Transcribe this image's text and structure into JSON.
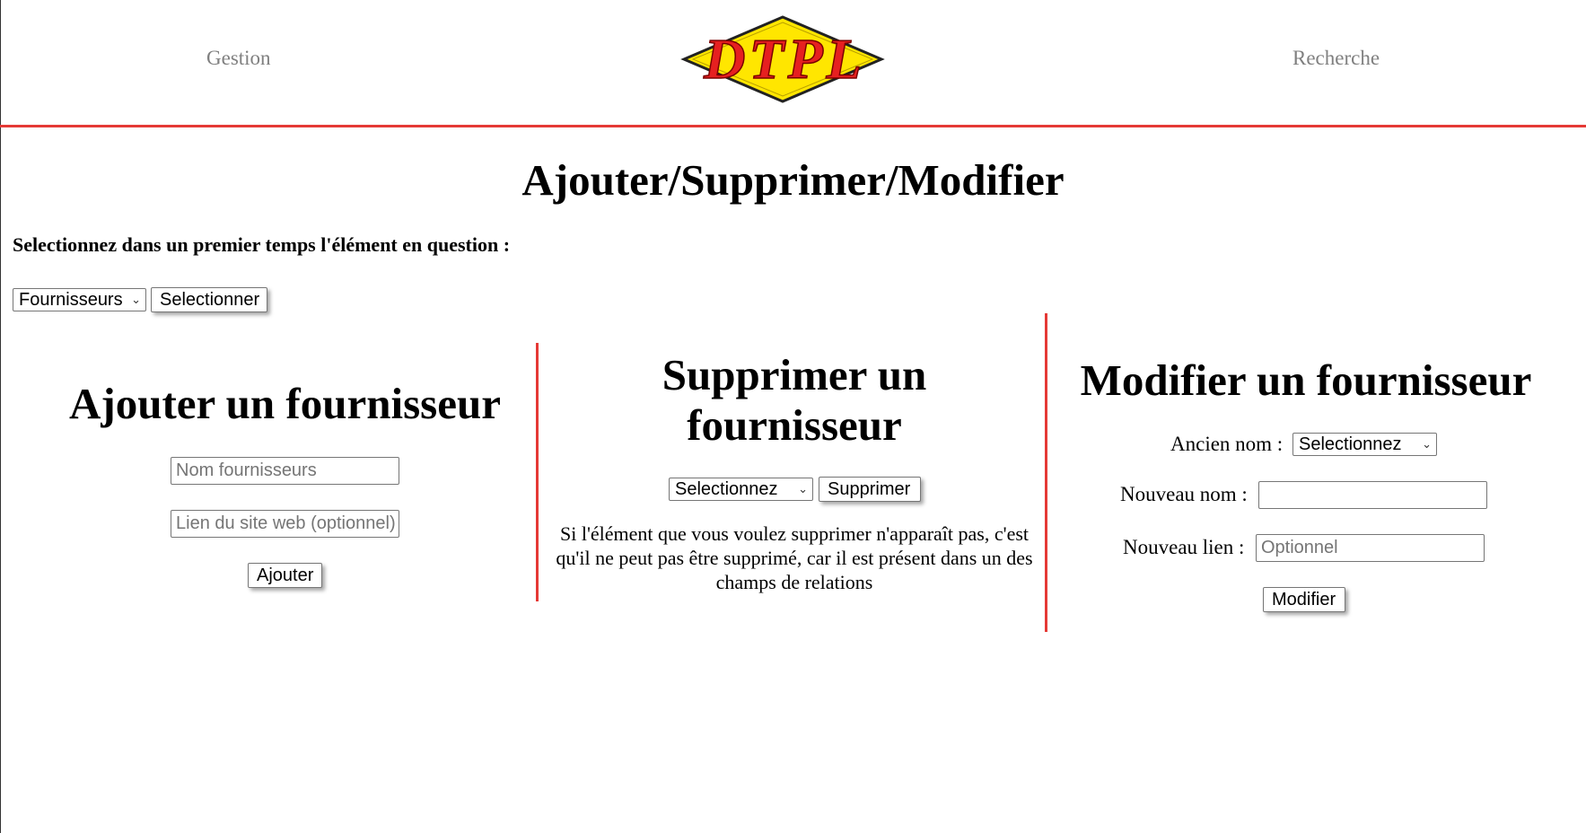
{
  "header": {
    "nav_left": "Gestion",
    "nav_right": "Recherche",
    "logo_text": "DTPL"
  },
  "colors": {
    "accent_red": "#e53935",
    "logo_yellow": "#ffe600",
    "nav_gray": "#808080"
  },
  "page_title": "Ajouter/Supprimer/Modifier",
  "instruction": "Selectionnez dans un premier temps l'élément en question :",
  "selector": {
    "value": "Fournisseurs",
    "button": "Selectionner"
  },
  "add_section": {
    "title": "Ajouter un fournisseur",
    "name_placeholder": "Nom fournisseurs",
    "link_placeholder": "Lien du site web (optionnel)",
    "button": "Ajouter"
  },
  "delete_section": {
    "title_line1": "Supprimer un",
    "title_line2": "fournisseur",
    "select_value": "Selectionnez",
    "button": "Supprimer",
    "note": "Si l'élément que vous voulez supprimer n'apparaît pas, c'est qu'il ne peut pas être supprimé, car il est présent dans un des champs de relations"
  },
  "modify_section": {
    "title": "Modifier un fournisseur",
    "old_name_label": "Ancien nom :",
    "old_name_value": "Selectionnez",
    "new_name_label": "Nouveau nom :",
    "new_name_value": "",
    "new_link_label": "Nouveau lien :",
    "new_link_placeholder": "Optionnel",
    "button": "Modifier"
  }
}
